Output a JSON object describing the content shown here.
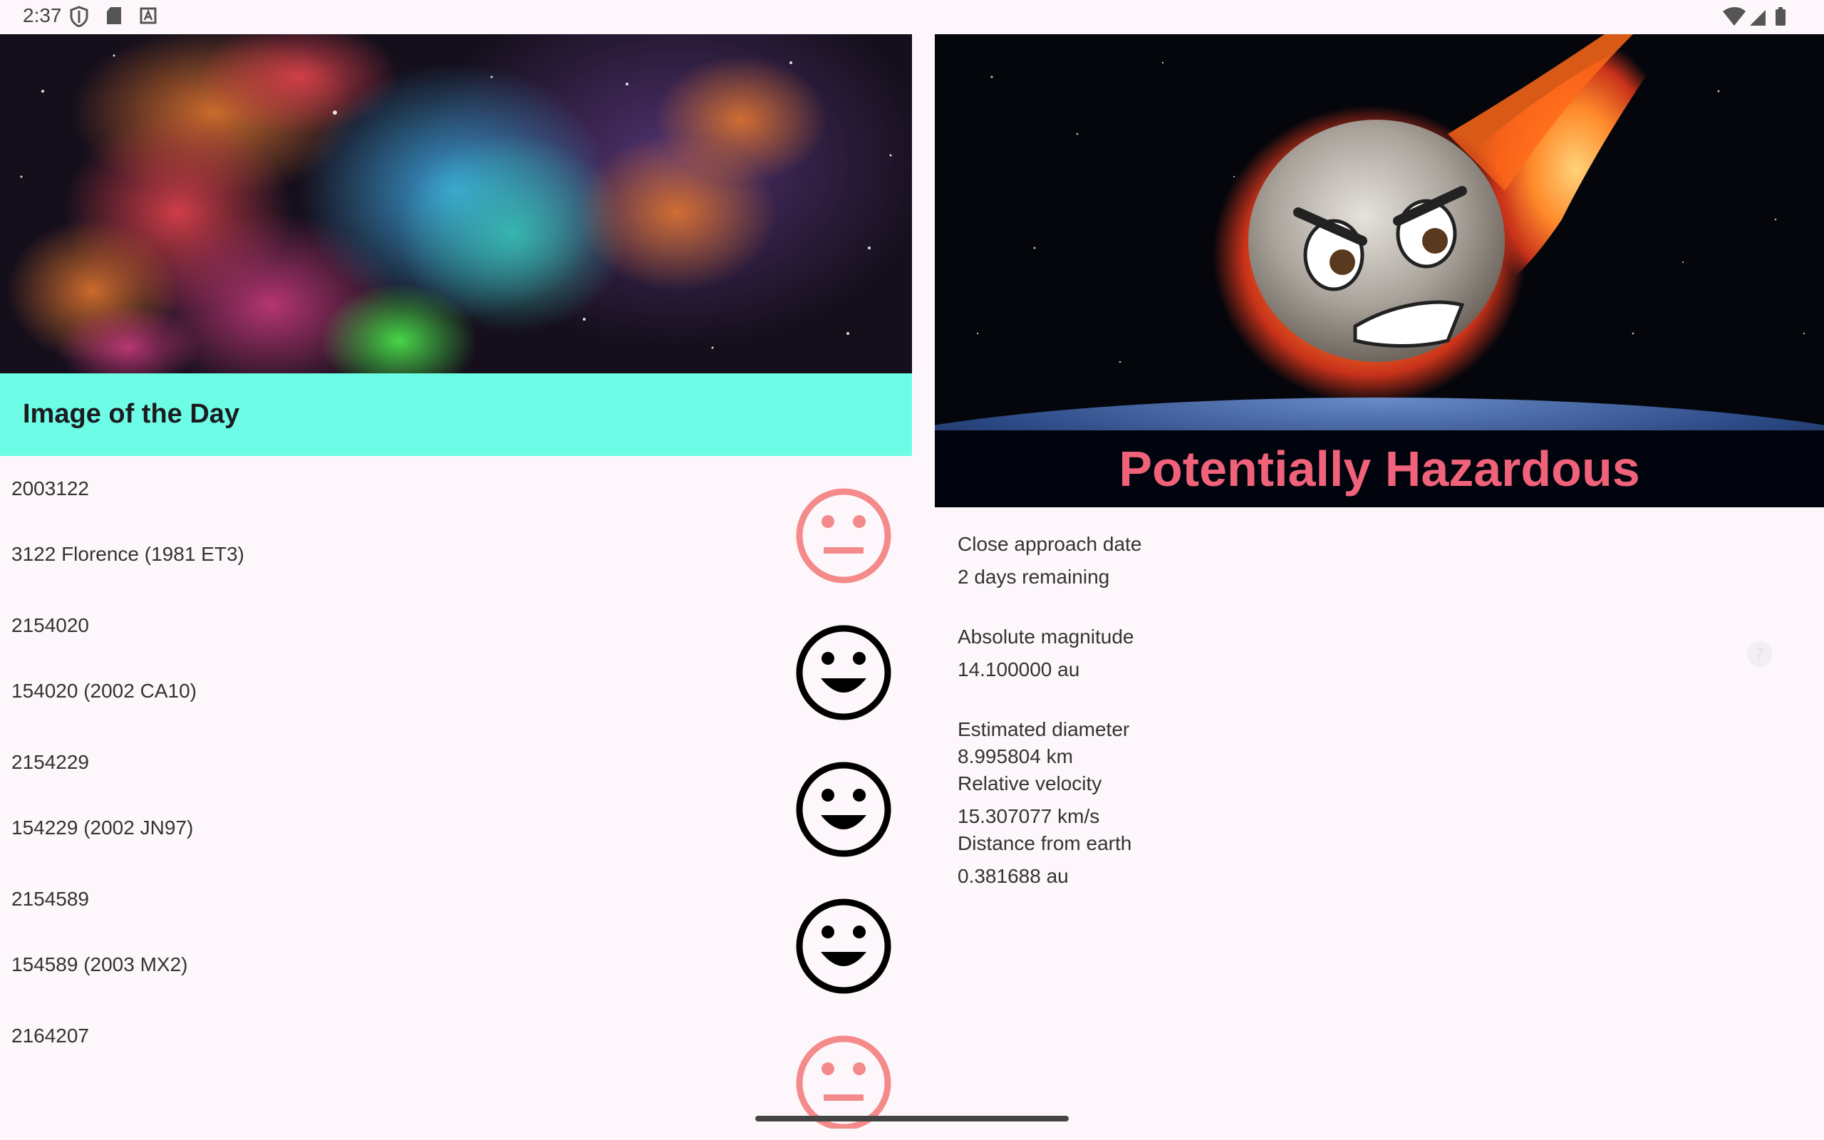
{
  "status_bar": {
    "time": "2:37",
    "icons_left": [
      "shield-icon",
      "sd-card-icon",
      "text-a-icon"
    ],
    "icons_right": [
      "wifi-icon",
      "signal-icon",
      "battery-icon"
    ]
  },
  "left": {
    "banner_title": "Image of the Day",
    "items": [
      {
        "id": "2003122",
        "name": "3122 Florence (1981 ET3)",
        "status": "neutral",
        "face_color": "#f58a8a"
      },
      {
        "id": "2154020",
        "name": "154020 (2002 CA10)",
        "status": "happy",
        "face_color": "#000000"
      },
      {
        "id": "2154229",
        "name": "154229 (2002 JN97)",
        "status": "happy",
        "face_color": "#000000"
      },
      {
        "id": "2154589",
        "name": "154589 (2003 MX2)",
        "status": "happy",
        "face_color": "#000000"
      },
      {
        "id": "2164207",
        "name": "",
        "status": "neutral",
        "face_color": "#f58a8a"
      }
    ]
  },
  "right": {
    "hazard_caption": "Potentially Hazardous",
    "close_approach_label": "Close approach date",
    "close_approach_value": "2 days remaining",
    "absolute_magnitude_label": "Absolute magnitude",
    "absolute_magnitude_value": "14.100000 au",
    "estimated_diameter_label": "Estimated diameter",
    "estimated_diameter_value": "8.995804 km",
    "relative_velocity_label": "Relative velocity",
    "relative_velocity_value": "15.307077 km/s",
    "distance_label": "Distance from earth",
    "distance_value": "0.381688 au"
  },
  "colors": {
    "banner": "#6dfde6",
    "hazard_text": "#f0617a",
    "background": "#fdf7fc"
  }
}
